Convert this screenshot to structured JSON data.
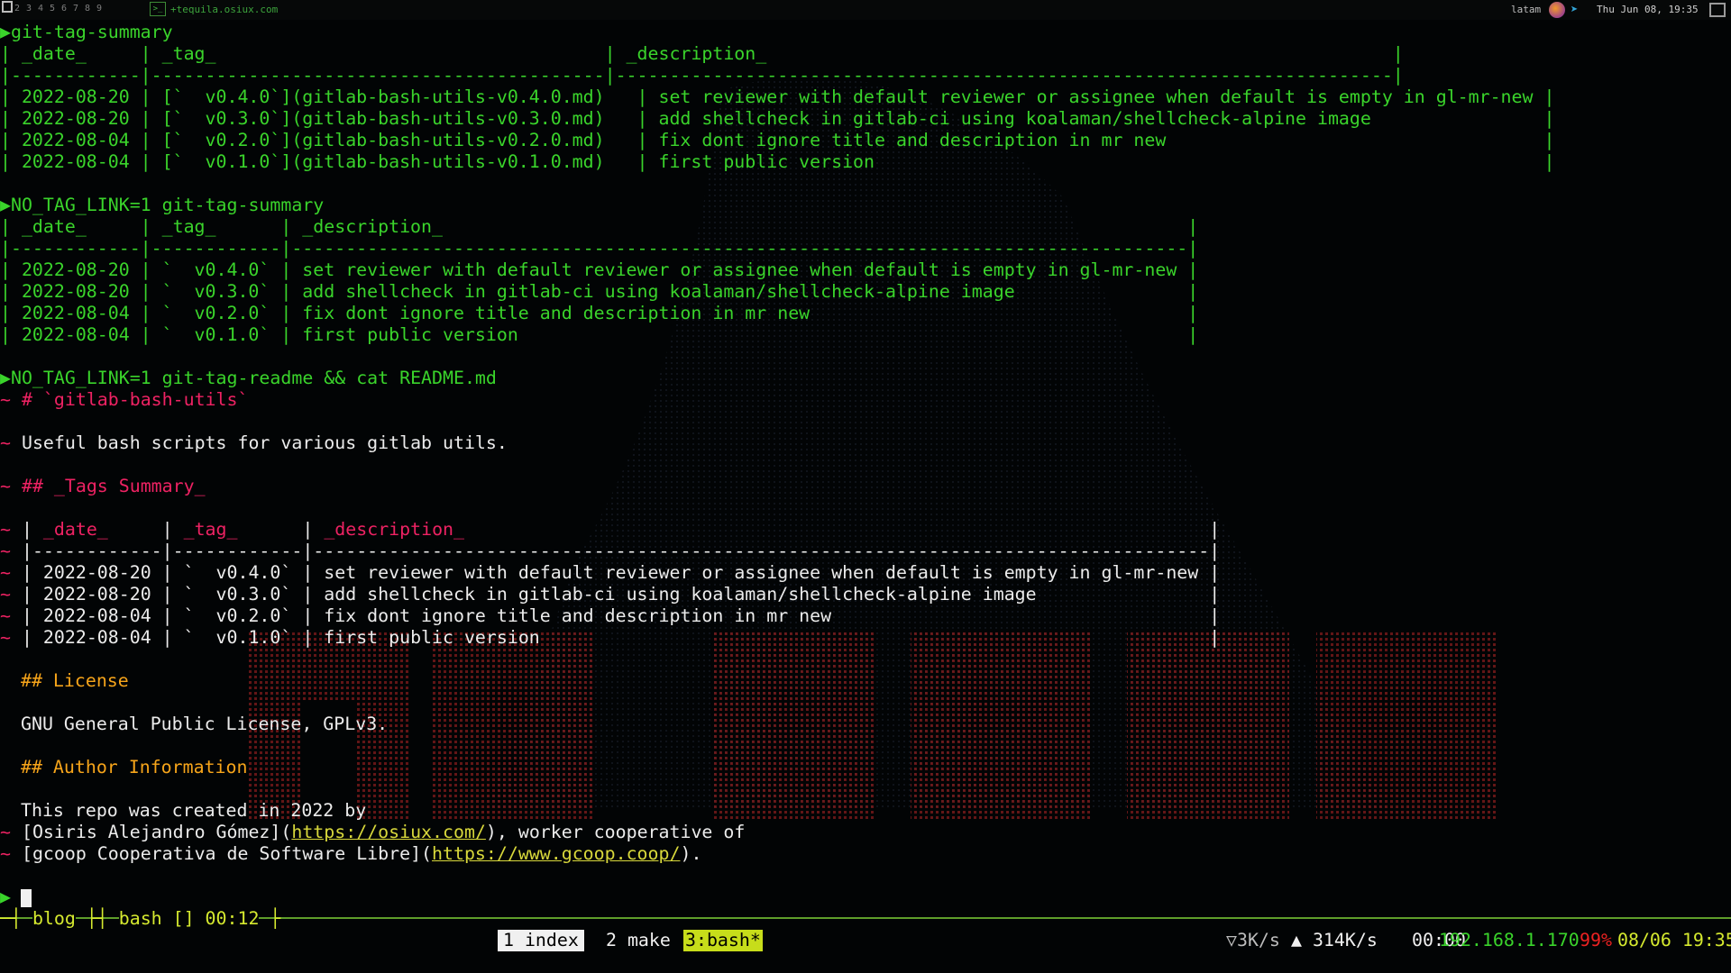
{
  "topbar": {
    "workspaces": [
      "1",
      "2",
      "3",
      "4",
      "5",
      "6",
      "7",
      "8",
      "9"
    ],
    "hostname": "+tequila.osiux.com",
    "keyboard_layout": "latam",
    "clock": "Thu Jun 08, 19:35",
    "icons": [
      "terminal-icon",
      "firefox-icon",
      "telegram-icon"
    ]
  },
  "terminal": {
    "prompt_glyph": "▶",
    "tilde": "~",
    "cmd1": "git-tag-summary",
    "t1_header": "| _date_     | _tag_                                    | _description_                                                          |",
    "t1_sep": "|------------|------------------------------------------|------------------------------------------------------------------------|",
    "t1_rows": [
      "| 2022-08-20 | [`  v0.4.0`](gitlab-bash-utils-v0.4.0.md)   | set reviewer with default reviewer or assignee when default is empty in gl-mr-new |",
      "| 2022-08-20 | [`  v0.3.0`](gitlab-bash-utils-v0.3.0.md)   | add shellcheck in gitlab-ci using koalaman/shellcheck-alpine image                |",
      "| 2022-08-04 | [`  v0.2.0`](gitlab-bash-utils-v0.2.0.md)   | fix dont ignore title and description in mr new                                   |",
      "| 2022-08-04 | [`  v0.1.0`](gitlab-bash-utils-v0.1.0.md)   | first public version                                                              |"
    ],
    "cmd2": "NO_TAG_LINK=1 git-tag-summary",
    "t2_header": "| _date_     | _tag_      | _description_                                                                     |",
    "t2_sep": "|------------|------------|-----------------------------------------------------------------------------------|",
    "t2_rows": [
      "| 2022-08-20 | `  v0.4.0` | set reviewer with default reviewer or assignee when default is empty in gl-mr-new |",
      "| 2022-08-20 | `  v0.3.0` | add shellcheck in gitlab-ci using koalaman/shellcheck-alpine image                |",
      "| 2022-08-04 | `  v0.2.0` | fix dont ignore title and description in mr new                                   |",
      "| 2022-08-04 | `  v0.1.0` | first public version                                                              |"
    ],
    "cmd3": "NO_TAG_LINK=1 git-tag-readme && cat README.md",
    "readme_title": "# `gitlab-bash-utils`",
    "readme_desc": "Useful bash scripts for various gitlab utils.",
    "tags_heading": "## _Tags Summary_",
    "md_h_bar1": "| ",
    "md_h_date": "_date_",
    "md_h_bar2": "     | ",
    "md_h_tag": "_tag_",
    "md_h_bar3": "      | ",
    "md_h_desc": "_description_",
    "md_h_bar4": "                                                                     |",
    "md_sep": "|------------|------------|-----------------------------------------------------------------------------------|",
    "md_rows": [
      "| 2022-08-20 | `  v0.4.0` | set reviewer with default reviewer or assignee when default is empty in gl-mr-new |",
      "| 2022-08-20 | `  v0.3.0` | add shellcheck in gitlab-ci using koalaman/shellcheck-alpine image                |",
      "| 2022-08-04 | `  v0.2.0` | fix dont ignore title and description in mr new                                   |",
      "| 2022-08-04 | `  v0.1.0` | first public version                                                              |"
    ],
    "license_heading": "## License",
    "license_text": "GNU General Public License, GPLv3.",
    "author_heading": "## Author Information",
    "author_line1": "This repo was created in 2022 by",
    "author_line2_a": "[Osiris Alejandro Gómez](",
    "author_line2_link": "https://osiux.com/",
    "author_line2_b": "), worker cooperative of",
    "author_line3_a": "[gcoop Cooperativa de Software Libre](",
    "author_line3_link": "https://www.gcoop.coop/",
    "author_line3_b": ")."
  },
  "tmux": {
    "pane1": "blog",
    "pane2": "bash [] 00:12",
    "windows": [
      {
        "label": "1 index"
      },
      {
        "label": "2 make"
      },
      {
        "label": "3:bash*"
      }
    ],
    "net_down": "▽3K/s",
    "net_up": "▲ 314K/s",
    "uptime": "00:00",
    "ip": "192.168.1.170",
    "battery": "99%",
    "datetime": "08/06 19:35"
  },
  "colors": {
    "green": "#3ad42b",
    "pink": "#ee2263",
    "orange": "#f7a51a",
    "lime": "#c7dd1a"
  }
}
